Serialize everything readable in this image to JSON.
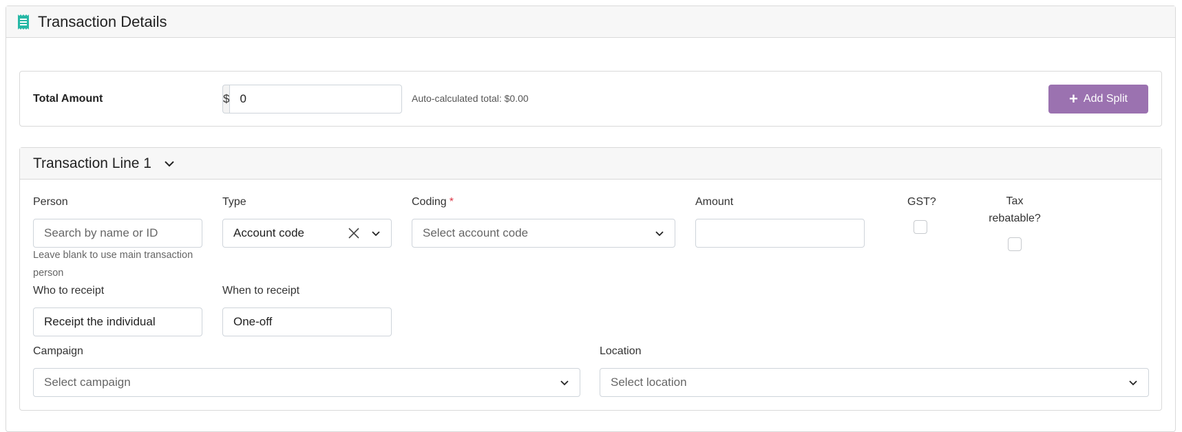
{
  "header": {
    "title": "Transaction Details",
    "icon": "receipt-icon",
    "icon_color": "#26b8a6"
  },
  "total": {
    "label": "Total Amount",
    "currency_symbol": "$",
    "value": "0",
    "auto_calculated": "Auto-calculated total: $0.00",
    "add_split_label": "Add Split",
    "add_split_color": "#9b72b0"
  },
  "line": {
    "title": "Transaction Line 1",
    "person": {
      "label": "Person",
      "placeholder": "Search by name or ID",
      "help": "Leave blank to use main transaction person"
    },
    "type": {
      "label": "Type",
      "value": "Account code"
    },
    "coding": {
      "label": "Coding",
      "required_mark": "*",
      "placeholder": "Select account code"
    },
    "amount": {
      "label": "Amount",
      "value": ""
    },
    "gst": {
      "label": "GST?",
      "checked": false
    },
    "tax_rebatable": {
      "label_line1": "Tax",
      "label_line2": "rebatable?",
      "checked": false
    },
    "who_to_receipt": {
      "label": "Who to receipt",
      "value": "Receipt the individual"
    },
    "when_to_receipt": {
      "label": "When to receipt",
      "value": "One-off"
    },
    "campaign": {
      "label": "Campaign",
      "placeholder": "Select campaign"
    },
    "location": {
      "label": "Location",
      "placeholder": "Select location"
    }
  }
}
